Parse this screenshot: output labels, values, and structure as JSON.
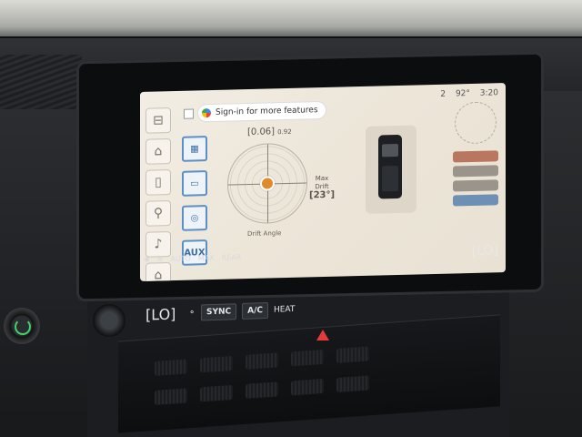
{
  "screen": {
    "assistant_chip": "Sign-in for more features",
    "status": {
      "volume": "2",
      "temp": "92°",
      "time": "3:20"
    },
    "modes": [
      "AUX"
    ],
    "gauge": {
      "readout": "[0.06]",
      "readout_small": "0.92",
      "max_label": "Max\nDrift",
      "max_value": "[23°]",
      "drift_label": "Drift Angle"
    }
  },
  "climate": {
    "lo_right": "[LO]",
    "auto_label": "AUTO",
    "max_label": "MAX",
    "rear_label": "REAR"
  },
  "controls": {
    "lo_left": "[LO]",
    "sync_label": "SYNC",
    "ac_label": "A/C",
    "heat_label": "HEAT"
  }
}
